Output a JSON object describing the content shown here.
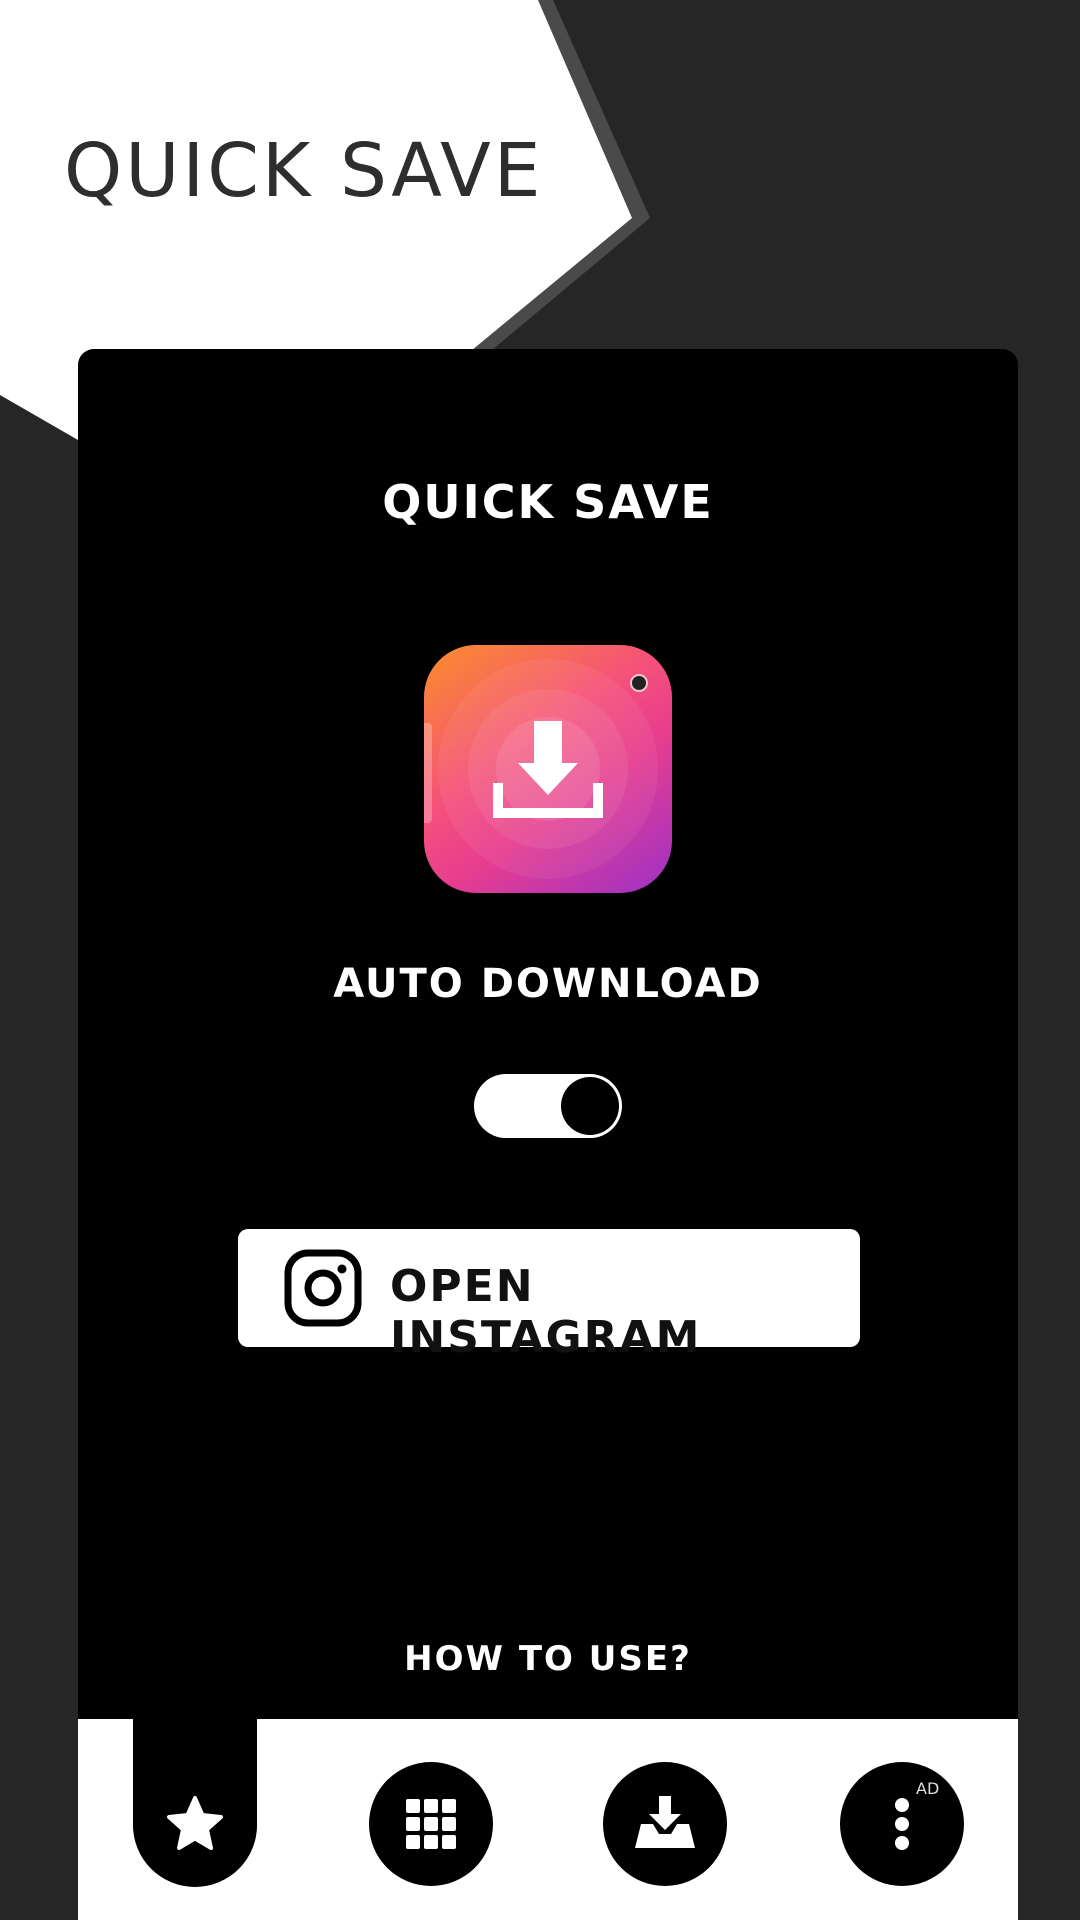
{
  "header": {
    "title": "QUICK SAVE"
  },
  "card": {
    "title": "QUICK SAVE",
    "app_icon": "download-icon",
    "auto_download_label": "AUTO DOWNLOAD",
    "auto_download_enabled": true,
    "open_button_label": "OPEN INSTAGRAM",
    "open_button_icon": "instagram-icon",
    "how_to_use_label": "HOW TO USE?"
  },
  "bottom_nav": {
    "items": [
      {
        "icon": "star-icon",
        "selected": true
      },
      {
        "icon": "grid-icon",
        "selected": false
      },
      {
        "icon": "download-tray-icon",
        "selected": false
      },
      {
        "icon": "more-vertical-icon",
        "selected": false,
        "badge": "AD"
      }
    ]
  },
  "colors": {
    "background": "#262626",
    "header_panel": "#ffffff",
    "card": "#000000",
    "icon_gradient": [
      "#fb8e2a",
      "#f5527a",
      "#9b32c8"
    ]
  }
}
